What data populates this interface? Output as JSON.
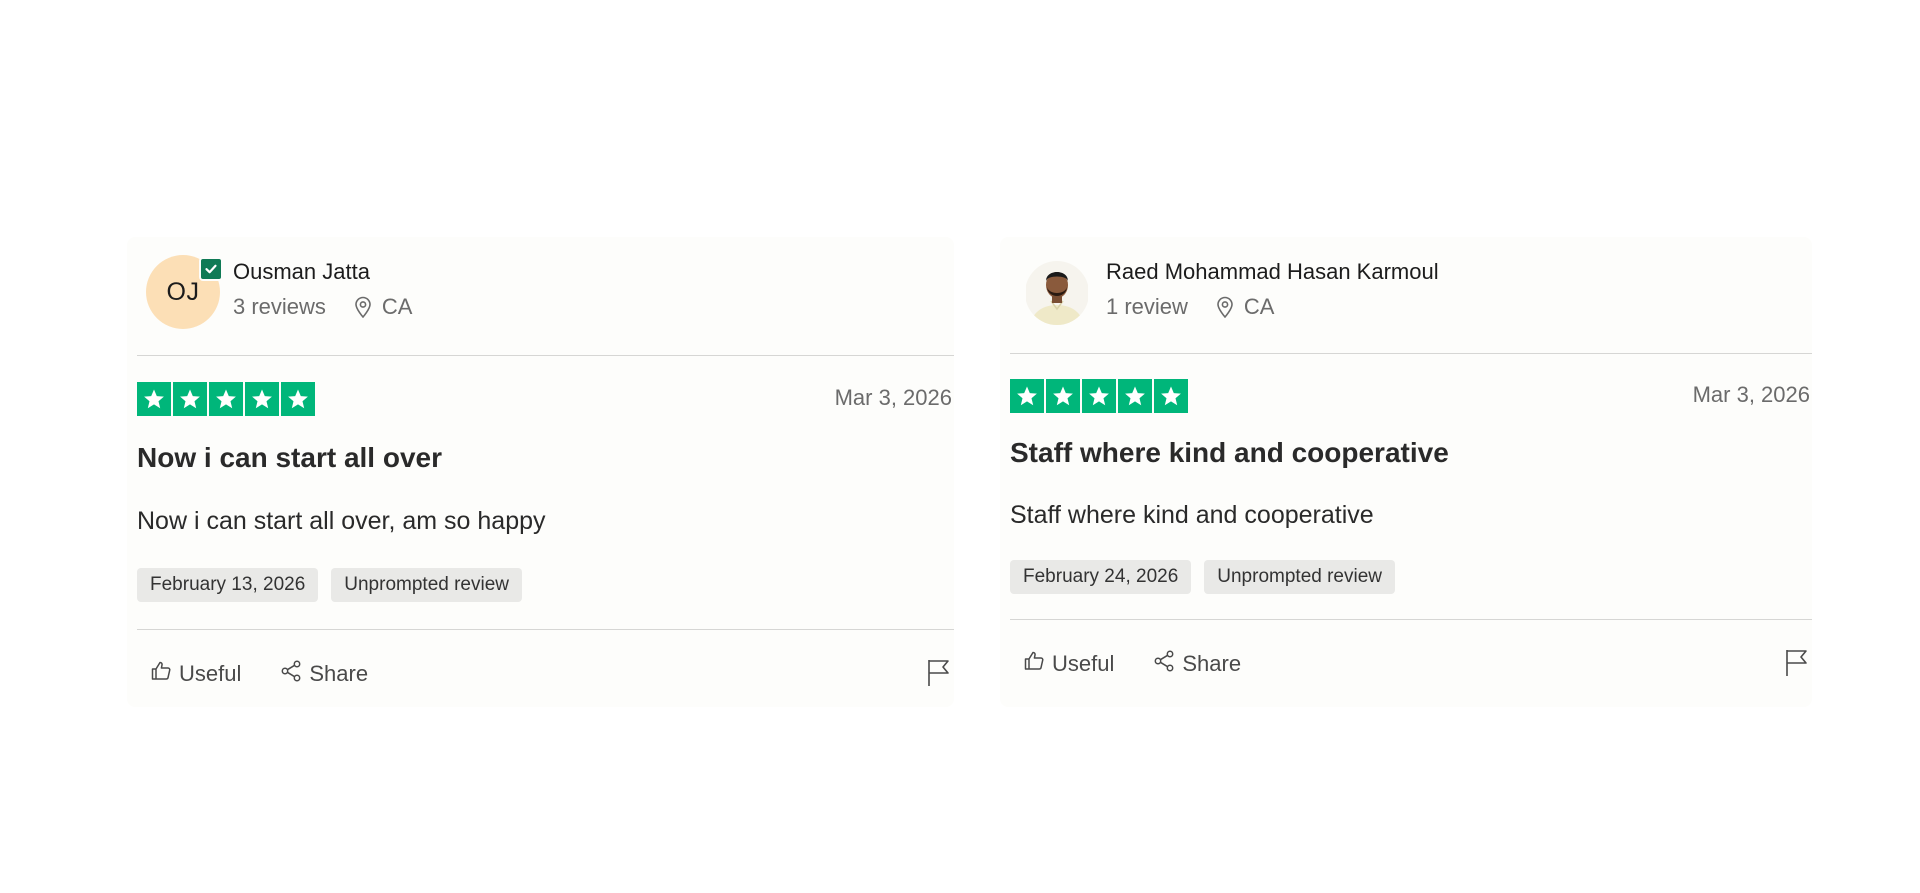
{
  "reviews": [
    {
      "avatar_initials": "OJ",
      "verified": true,
      "name": "Ousman Jatta",
      "review_count": "3 reviews",
      "country": "CA",
      "rating": 5,
      "date": "Mar 3, 2026",
      "title": "Now i can start all over",
      "body": "Now i can start all over, am so happy",
      "experience_date": "February 13, 2026",
      "tag": "Unprompted review",
      "useful_label": "Useful",
      "share_label": "Share"
    },
    {
      "avatar_initials": "",
      "verified": false,
      "name": "Raed Mohammad Hasan Karmoul",
      "review_count": "1 review",
      "country": "CA",
      "rating": 5,
      "date": "Mar 3, 2026",
      "title": "Staff where kind and cooperative",
      "body": "Staff where kind and cooperative",
      "experience_date": "February 24, 2026",
      "tag": "Unprompted review",
      "useful_label": "Useful",
      "share_label": "Share"
    }
  ],
  "colors": {
    "star_green": "#00b67a",
    "verified_green": "#0f7a55",
    "avatar_bg": "#fcdfb6"
  },
  "icons": [
    "verified-check-icon",
    "location-pin-icon",
    "star-icon",
    "thumbs-up-icon",
    "share-icon",
    "flag-icon"
  ]
}
